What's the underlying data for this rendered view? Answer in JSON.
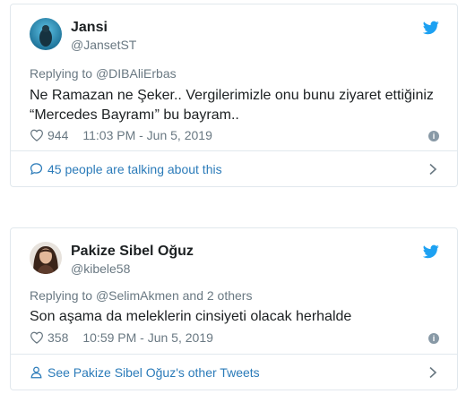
{
  "tweets": [
    {
      "name": "Jansi",
      "handle": "@JansetST",
      "replying_prefix": "Replying to ",
      "replying_to": "@DIBAliErbas",
      "text_line1": "Ne Ramazan ne Şeker..  Vergilerimizle onu bunu ziyaret ettiğiniz",
      "text_line2": "“Mercedes Bayramı” bu bayram..",
      "likes": "944",
      "timestamp": "11:03 PM - Jun 5, 2019",
      "footer": "45 people are talking about this",
      "footer_icon": "speech-bubble-icon"
    },
    {
      "name": "Pakize Sibel Oğuz",
      "handle": "@kibele58",
      "replying_prefix": "Replying to ",
      "replying_to": "@SelimAkmen",
      "replying_suffix": " and 2 others",
      "text_line1": "Son aşama da meleklerin cinsiyeti olacak herhalde",
      "likes": "358",
      "timestamp": "10:59 PM - Jun 5, 2019",
      "footer": "See Pakize Sibel Oğuz's other Tweets",
      "footer_icon": "person-icon"
    }
  ],
  "colors": {
    "link": "#2b7bb9",
    "muted": "#697882",
    "text": "#1c2022",
    "twitter_blue": "#1da1f2",
    "border": "#e1e8ed"
  },
  "icons": {
    "brand": "twitter-bird-icon",
    "like": "heart-icon",
    "info": "info-icon",
    "chevron": "chevron-right-icon"
  }
}
